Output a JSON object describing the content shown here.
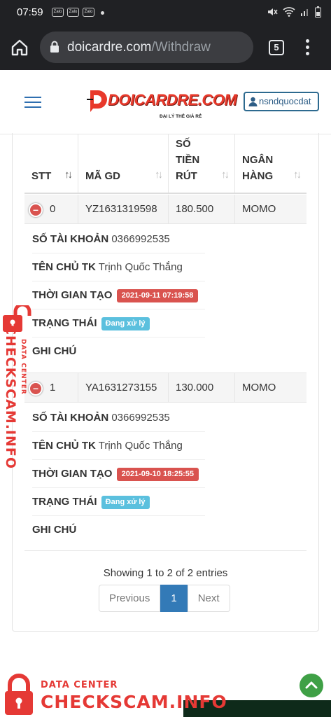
{
  "status_bar": {
    "time": "07:59",
    "notification_icons": [
      "Zalo",
      "Zalo",
      "Zalo"
    ]
  },
  "browser": {
    "url_host": "doicardre.com",
    "url_path": "/Withdraw",
    "tab_count": "5"
  },
  "header": {
    "logo_text": "DOICARDRE.COM",
    "logo_tagline": "ĐẠI LÝ THẺ GIÁ RẺ",
    "username": "nsndquocdat"
  },
  "table": {
    "columns": [
      {
        "line1": "STT",
        "line2": "",
        "line3": ""
      },
      {
        "line1": "MÃ GD",
        "line2": "",
        "line3": ""
      },
      {
        "line1": "SỐ",
        "line2": "TIỀN",
        "line3": "RÚT"
      },
      {
        "line1": "NGÂN",
        "line2": "HÀNG",
        "line3": ""
      }
    ],
    "detail_labels": {
      "account_no": "SỐ TÀI KHOẢN",
      "owner": "TÊN CHỦ TK",
      "created": "THỜI GIAN TẠO",
      "status": "TRẠNG THÁI",
      "note": "GHI CHÚ"
    },
    "rows": [
      {
        "stt": "0",
        "code": "YZ1631319598",
        "amount": "180.500",
        "bank": "MOMO",
        "account_no": "0366992535",
        "owner": "Trịnh Quốc Thắng",
        "created": "2021-09-11 07:19:58",
        "status": "Đang xử lý",
        "note": ""
      },
      {
        "stt": "1",
        "code": "YA1631273155",
        "amount": "130.000",
        "bank": "MOMO",
        "account_no": "0366992535",
        "owner": "Trịnh Quốc Thắng",
        "created": "2021-09-10 18:25:55",
        "status": "Đang xử lý",
        "note": ""
      }
    ]
  },
  "pagination": {
    "info": "Showing 1 to 2 of 2 entries",
    "previous": "Previous",
    "current": "1",
    "next": "Next"
  },
  "watermark": {
    "small": "DATA CENTER",
    "big": "CHECKSCAM.INFO"
  },
  "colors": {
    "danger": "#d9534f",
    "info": "#5bc0de",
    "primary": "#337ab7",
    "brand_red": "#e8392b",
    "scroll_top": "#3fa046"
  }
}
